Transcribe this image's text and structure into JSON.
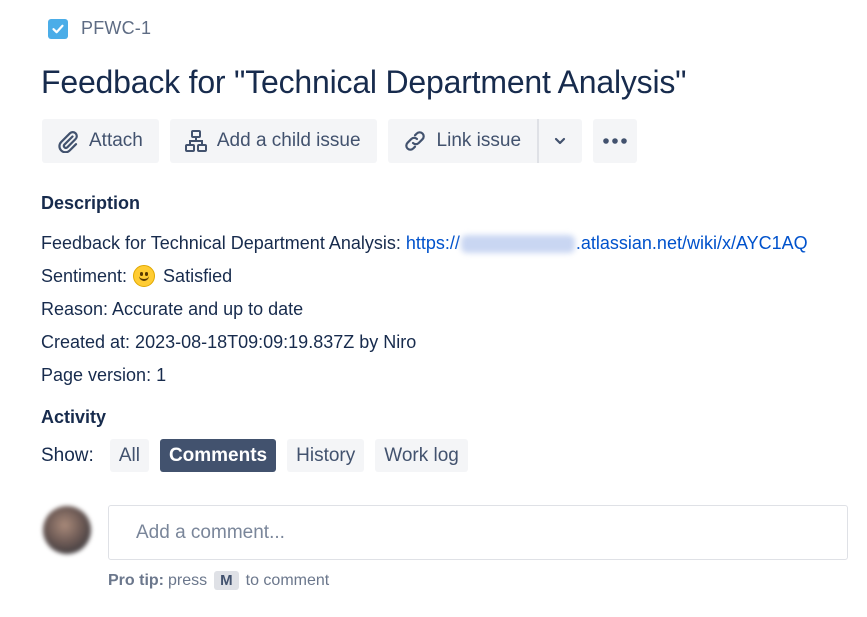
{
  "issue": {
    "key": "PFWC-1",
    "type_icon": "checkbox-icon",
    "title": "Feedback for \"Technical Department Analysis\""
  },
  "toolbar": {
    "attach_label": "Attach",
    "child_issue_label": "Add a child issue",
    "link_issue_label": "Link issue"
  },
  "description": {
    "heading": "Description",
    "line1_prefix": "Feedback for Technical Department Analysis: ",
    "link_start": "https://",
    "link_end": ".atlassian.net/wiki/x/AYC1AQ",
    "sentiment_label": "Sentiment:",
    "sentiment_value": "Satisfied",
    "reason": "Reason: Accurate and up to date",
    "created": "Created at: 2023-08-18T09:09:19.837Z by Niro",
    "page_version": "Page version: 1"
  },
  "activity": {
    "heading": "Activity",
    "show_label": "Show:",
    "filters": [
      "All",
      "Comments",
      "History",
      "Work log"
    ],
    "active_filter": "Comments"
  },
  "comment": {
    "placeholder": "Add a comment...",
    "protip_label": "Pro tip:",
    "protip_press": "press",
    "protip_key": "M",
    "protip_suffix": "to comment"
  },
  "colors": {
    "link": "#0052cc",
    "title": "#172b4d",
    "button_bg": "#f4f5f7",
    "active_filter_bg": "#42526e",
    "type_icon": "#4bade8"
  }
}
